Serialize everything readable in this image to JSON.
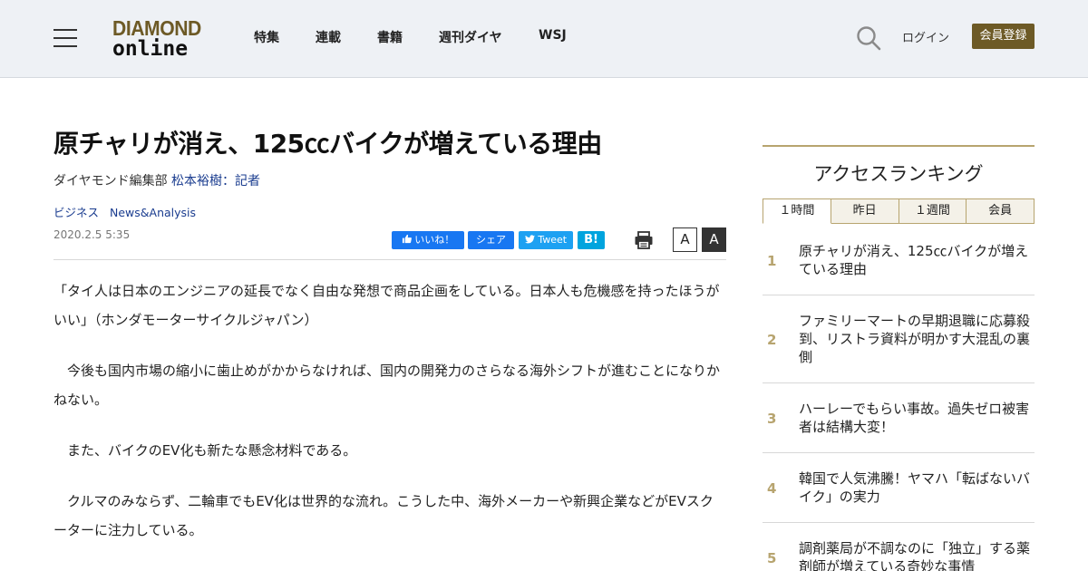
{
  "header": {
    "logo_line1": "DIAMOND",
    "logo_line2": "online",
    "nav": [
      "特集",
      "連載",
      "書籍",
      "週刊ダイヤ",
      "WSJ"
    ],
    "login": "ログイン",
    "register": "会員登録"
  },
  "article": {
    "title": "原チャリが消え、125㏄バイクが増えている理由",
    "byline_prefix": "ダイヤモンド編集部 ",
    "byline_author": "松本裕樹：記者",
    "tags": [
      "ビジネス",
      "News&Analysis"
    ],
    "date": "2020.2.5 5:35",
    "social": {
      "like": "いいね！",
      "share": "シェア",
      "tweet": "Tweet",
      "hatena": "B!"
    },
    "font_small": "A",
    "font_large": "A",
    "paragraphs": [
      "「タイ人は日本のエンジニアの延長でなく自由な発想で商品企画をしている。日本人も危機感を持ったほうがいい」（ホンダモーターサイクルジャパン）",
      "　今後も国内市場の縮小に歯止めがかからなければ、国内の開発力のさらなる海外シフトが進むことになりかねない。",
      "　また、バイクのEV化も新たな懸念材料である。",
      "　クルマのみならず、二輪車でもEV化は世界的な流れ。こうした中、海外メーカーや新興企業などがEVスクーターに注力している。"
    ]
  },
  "sidebar": {
    "title": "アクセスランキング",
    "tabs": [
      "１時間",
      "昨日",
      "１週間",
      "会員"
    ],
    "ranking": [
      {
        "num": "1",
        "text": "原チャリが消え、125㏄バイクが増えている理由"
      },
      {
        "num": "2",
        "text": "ファミリーマートの早期退職に応募殺到、リストラ資料が明かす大混乱の裏側"
      },
      {
        "num": "3",
        "text": "ハーレーでもらい事故。過失ゼロ被害者は結構大変！"
      },
      {
        "num": "4",
        "text": "韓国で人気沸騰！ヤマハ「転ばないバイク」の実力"
      },
      {
        "num": "5",
        "text": "調剤薬局が不調なのに「独立」する薬剤師が増えている奇妙な事情"
      }
    ]
  }
}
